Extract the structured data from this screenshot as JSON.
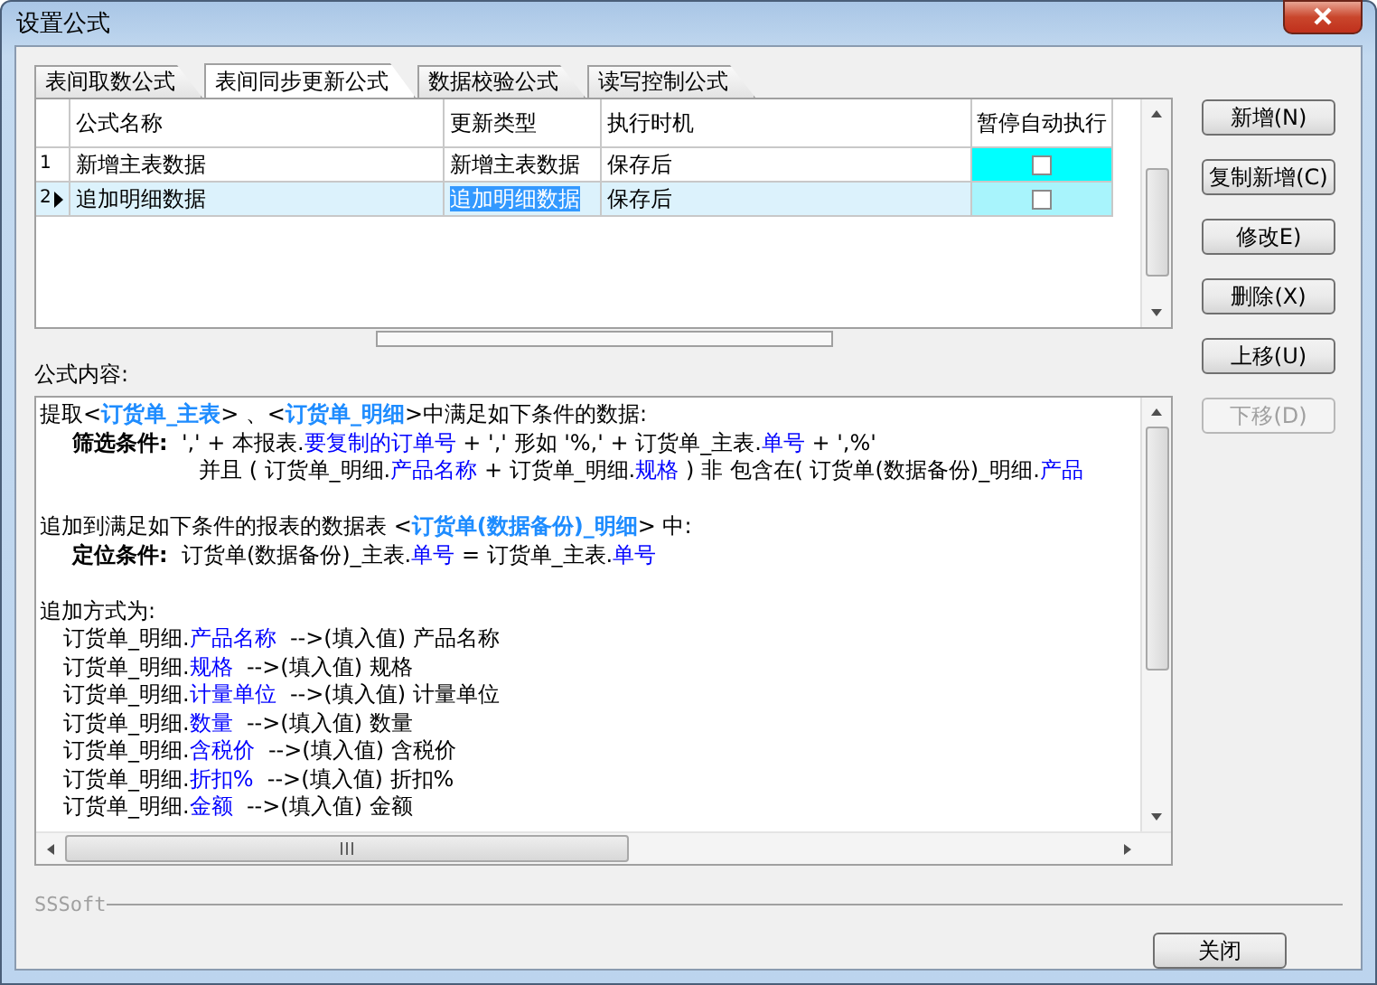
{
  "window": {
    "title": "设置公式"
  },
  "tabs": [
    {
      "label": "表间取数公式",
      "selected": false
    },
    {
      "label": "表间同步更新公式",
      "selected": true
    },
    {
      "label": "数据校验公式",
      "selected": false
    },
    {
      "label": "读写控制公式",
      "selected": false
    }
  ],
  "table": {
    "columns": [
      "公式名称",
      "更新类型",
      "执行时机",
      "暂停自动执行"
    ],
    "rows": [
      {
        "number": "1",
        "name": "新增主表数据",
        "update_type": "新增主表数据",
        "timing": "保存后",
        "paused": false,
        "selected": false
      },
      {
        "number": "2",
        "name": "追加明细数据",
        "update_type": "追加明细数据",
        "timing": "保存后",
        "paused": false,
        "selected": true
      }
    ]
  },
  "formula": {
    "label": "公式内容:",
    "lines": [
      {
        "kind": "top",
        "segments": [
          {
            "kind": "plain",
            "text": "提取<"
          },
          {
            "kind": "ref",
            "text": "订货单_主表"
          },
          {
            "kind": "plain",
            "text": "> 、<"
          },
          {
            "kind": "ref",
            "text": "订货单_明细"
          },
          {
            "kind": "plain",
            "text": ">中满足如下条件的数据:"
          }
        ]
      },
      {
        "kind": "sub",
        "segments": [
          {
            "kind": "label",
            "text": "筛选条件:"
          },
          {
            "kind": "plain",
            "text": "  ',' + 本报表."
          },
          {
            "kind": "field",
            "text": "要复制的订单号"
          },
          {
            "kind": "plain",
            "text": " + ',' 形如 '%,' + 订货单_主表."
          },
          {
            "kind": "field",
            "text": "单号"
          },
          {
            "kind": "plain",
            "text": " + ',%'"
          }
        ]
      },
      {
        "kind": "cont",
        "segments": [
          {
            "kind": "plain",
            "text": "并且 ( 订货单_明细."
          },
          {
            "kind": "field",
            "text": "产品名称"
          },
          {
            "kind": "plain",
            "text": " + 订货单_明细."
          },
          {
            "kind": "field",
            "text": "规格"
          },
          {
            "kind": "plain",
            "text": " ) 非 包含在( 订货单(数据备份)_明细."
          },
          {
            "kind": "field",
            "text": "产品"
          }
        ]
      },
      {
        "kind": "section",
        "segments": [
          {
            "kind": "plain",
            "text": "追加到满足如下条件的报表的数据表 <"
          },
          {
            "kind": "ref",
            "text": "订货单(数据备份)_明细"
          },
          {
            "kind": "plain",
            "text": "> 中:"
          }
        ]
      },
      {
        "kind": "sub",
        "segments": [
          {
            "kind": "label",
            "text": "定位条件:"
          },
          {
            "kind": "plain",
            "text": "  订货单(数据备份)_主表."
          },
          {
            "kind": "field",
            "text": "单号"
          },
          {
            "kind": "plain",
            "text": " = 订货单_主表."
          },
          {
            "kind": "field",
            "text": "单号"
          }
        ]
      },
      {
        "kind": "section",
        "segments": [
          {
            "kind": "plain",
            "text": "追加方式为:"
          }
        ]
      },
      {
        "kind": "map",
        "segments": [
          {
            "kind": "plain",
            "text": "订货单_明细."
          },
          {
            "kind": "field",
            "text": "产品名称"
          },
          {
            "kind": "plain",
            "text": "  -->(填入值) 产品名称"
          }
        ]
      },
      {
        "kind": "map",
        "segments": [
          {
            "kind": "plain",
            "text": "订货单_明细."
          },
          {
            "kind": "field",
            "text": "规格"
          },
          {
            "kind": "plain",
            "text": "  -->(填入值) 规格"
          }
        ]
      },
      {
        "kind": "map",
        "segments": [
          {
            "kind": "plain",
            "text": "订货单_明细."
          },
          {
            "kind": "field",
            "text": "计量单位"
          },
          {
            "kind": "plain",
            "text": "  -->(填入值) 计量单位"
          }
        ]
      },
      {
        "kind": "map",
        "segments": [
          {
            "kind": "plain",
            "text": "订货单_明细."
          },
          {
            "kind": "field",
            "text": "数量"
          },
          {
            "kind": "plain",
            "text": "  -->(填入值) 数量"
          }
        ]
      },
      {
        "kind": "map",
        "segments": [
          {
            "kind": "plain",
            "text": "订货单_明细."
          },
          {
            "kind": "field",
            "text": "含税价"
          },
          {
            "kind": "plain",
            "text": "  -->(填入值) 含税价"
          }
        ]
      },
      {
        "kind": "map",
        "segments": [
          {
            "kind": "plain",
            "text": "订货单_明细."
          },
          {
            "kind": "field",
            "text": "折扣%"
          },
          {
            "kind": "plain",
            "text": "  -->(填入值) 折扣%"
          }
        ]
      },
      {
        "kind": "map",
        "segments": [
          {
            "kind": "plain",
            "text": "订货单_明细."
          },
          {
            "kind": "field",
            "text": "金额"
          },
          {
            "kind": "plain",
            "text": "  -->(填入值) 金额"
          }
        ]
      }
    ]
  },
  "buttons": [
    {
      "label": "新增(N)",
      "disabled": false
    },
    {
      "label": "复制新增(C)",
      "disabled": false
    },
    {
      "label": "修改E)",
      "disabled": false
    },
    {
      "label": "删除(X)",
      "disabled": false
    },
    {
      "label": "上移(U)",
      "disabled": false
    },
    {
      "label": "下移(D)",
      "disabled": true
    }
  ],
  "footer": {
    "brand": "SSSoft",
    "close_button": "关闭"
  }
}
